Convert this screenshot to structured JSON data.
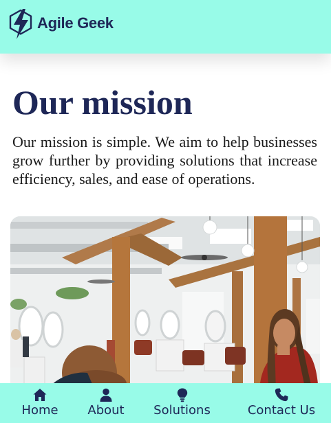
{
  "header": {
    "brand": "Agile Geek",
    "logo_icon": "lightning-bolt-icon"
  },
  "main": {
    "title": "Our mission",
    "description": "Our mission is simple. We aim to help businesses grow further by providing solutions that increase efficiency, sales, and ease of operations.",
    "image_subject": "salon-interior-photo"
  },
  "bottom_nav": {
    "items": [
      {
        "label": "Home",
        "icon": "home-icon"
      },
      {
        "label": "About",
        "icon": "user-icon"
      },
      {
        "label": "Solutions",
        "icon": "lightbulb-icon"
      },
      {
        "label": "Contact Us",
        "icon": "phone-icon"
      }
    ]
  },
  "colors": {
    "header_bg": "#98fbe8",
    "brand_navy": "#1e2757",
    "text": "#1a1a1a"
  }
}
